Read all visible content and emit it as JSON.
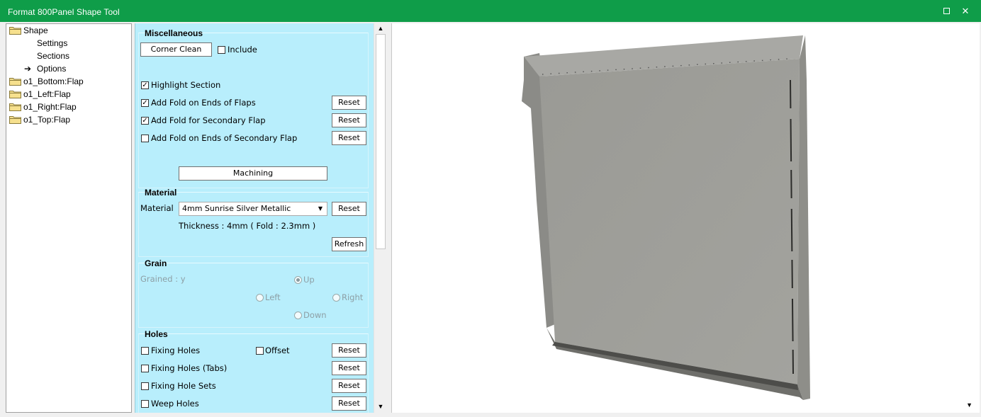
{
  "window": {
    "title": "Format 800Panel Shape Tool"
  },
  "tree": {
    "root": "Shape",
    "children": [
      "Settings",
      "Sections",
      "Options"
    ],
    "flaps": [
      "o1_Bottom:Flap",
      "o1_Left:Flap",
      "o1_Right:Flap",
      "o1_Top:Flap"
    ]
  },
  "misc": {
    "title": "Miscellaneous",
    "corner_clean": "Corner Clean",
    "include": "Include",
    "highlight_section": "Highlight Section",
    "fold_ends_flaps": "Add Fold on Ends of Flaps",
    "fold_secondary": "Add Fold for Secondary Flap",
    "fold_ends_secondary": "Add Fold on Ends of Secondary Flap",
    "machining": "Machining",
    "reset": "Reset",
    "checks": {
      "include": false,
      "highlight": true,
      "fold_ends": true,
      "fold_secondary": true,
      "fold_ends_secondary": false
    }
  },
  "material": {
    "title": "Material",
    "label": "Material",
    "value": "4mm Sunrise Silver Metallic",
    "thickness": "Thickness : 4mm ( Fold : 2.3mm )",
    "reset": "Reset",
    "refresh": "Refresh"
  },
  "grain": {
    "title": "Grain",
    "grained": "Grained : y",
    "up": "Up",
    "left": "Left",
    "right": "Right",
    "down": "Down",
    "selected": "Up"
  },
  "holes": {
    "title": "Holes",
    "fixing": "Fixing Holes",
    "offset": "Offset",
    "fixing_tabs": "Fixing Holes (Tabs)",
    "fixing_sets": "Fixing Hole Sets",
    "weep": "Weep Holes",
    "reset": "Reset"
  },
  "colors": {
    "titlebar": "#0f9d49",
    "panel": "#b8eefc",
    "panel3d": "#9b9b96"
  },
  "icons": {
    "folder": "folder-icon",
    "arrow": "arrow-right-icon",
    "maximize": "maximize-icon",
    "close": "close-icon"
  }
}
